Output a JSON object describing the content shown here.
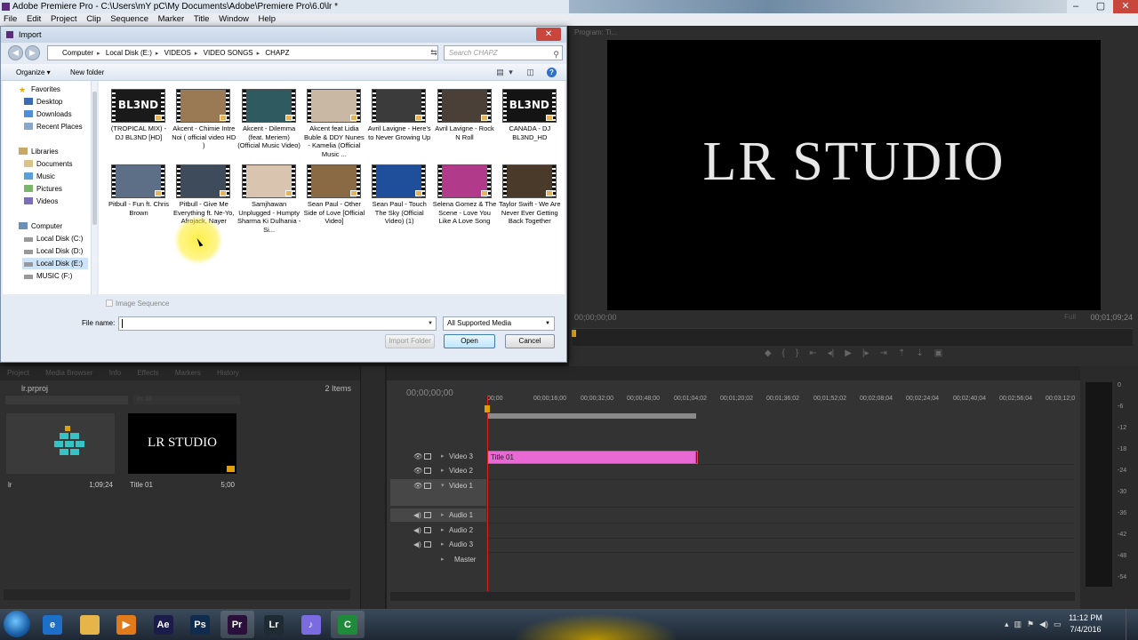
{
  "window": {
    "title": "Adobe Premiere Pro - C:\\Users\\mY pC\\My Documents\\Adobe\\Premiere Pro\\6.0\\lr *",
    "controls": [
      "–",
      "▢",
      "✕"
    ]
  },
  "menu": [
    "File",
    "Edit",
    "Project",
    "Clip",
    "Sequence",
    "Marker",
    "Title",
    "Window",
    "Help"
  ],
  "import_dialog": {
    "title": "Import",
    "breadcrumb": [
      "Computer",
      "Local Disk (E:)",
      "VIDEOS",
      "VIDEO SONGS",
      "CHAPZ"
    ],
    "search_placeholder": "Search CHAPZ",
    "toolbar": {
      "organize": "Organize ▾",
      "new_folder": "New folder"
    },
    "nav": {
      "favorites_header": "Favorites",
      "favorites": [
        "Desktop",
        "Downloads",
        "Recent Places"
      ],
      "libraries_header": "Libraries",
      "libraries": [
        "Documents",
        "Music",
        "Pictures",
        "Videos"
      ],
      "computer_header": "Computer",
      "drives": [
        "Local Disk (C:)",
        "Local Disk (D:)",
        "Local Disk (E:)",
        "MUSIC (F:)"
      ]
    },
    "files": [
      {
        "name": "(TROPICAL MIX) - DJ BL3ND [HD]",
        "thumb": "#1a1a1a",
        "text": "BL3ND"
      },
      {
        "name": "Akcent - Chimie Intre Noi ( official video HD )",
        "thumb": "#9a7a55",
        "text": ""
      },
      {
        "name": "Akcent - Dilemma (feat. Meriem) (Official Music Video)",
        "thumb": "#2f5a5f",
        "text": ""
      },
      {
        "name": "Akcent feat Lidia Buble & DDY Nunes - Kamelia (Official Music ...",
        "thumb": "#c9b8a3",
        "text": ""
      },
      {
        "name": "Avril Lavigne - Here's to Never Growing Up",
        "thumb": "#3b3b3b",
        "text": ""
      },
      {
        "name": "Avril Lavigne - Rock N Roll",
        "thumb": "#4a4038",
        "text": ""
      },
      {
        "name": "CANADA - DJ BL3ND_HD",
        "thumb": "#141414",
        "text": "BL3ND"
      },
      {
        "name": "Pitbull - Fun ft. Chris Brown",
        "thumb": "#5d6f86",
        "text": ""
      },
      {
        "name": "Pitbull - Give Me Everything ft. Ne-Yo, Afrojack, Nayer",
        "thumb": "#3e4b5a",
        "text": ""
      },
      {
        "name": "Samjhawan Unplugged - Humpty Sharma Ki Dulhania - Si...",
        "thumb": "#d9c4b0",
        "text": ""
      },
      {
        "name": "Sean Paul - Other Side of Love [Official Video]",
        "thumb": "#8a6a45",
        "text": ""
      },
      {
        "name": "Sean Paul - Touch The Sky (Official Video) (1)",
        "thumb": "#1f4f9a",
        "text": ""
      },
      {
        "name": "Selena Gomez & The Scene - Love You Like A Love Song",
        "thumb": "#b23a8a",
        "text": ""
      },
      {
        "name": "Taylor Swift - We Are Never Ever Getting Back Together",
        "thumb": "#4a3a2a",
        "text": ""
      }
    ],
    "image_sequence_label": "Image Sequence",
    "file_name_label": "File name:",
    "file_name_value": "",
    "file_type": "All Supported Media",
    "buttons": {
      "import_folder": "Import Folder",
      "open": "Open",
      "cancel": "Cancel"
    }
  },
  "program_monitor": {
    "tab": "Program: Ti...",
    "title_text": "LR STUDIO",
    "timecode_left": "00;00;00;00",
    "timecode_right": "00;01;09;24",
    "fit": "Full"
  },
  "project_panel": {
    "tabs": [
      "Project",
      "Media Browser",
      "Info",
      "Effects",
      "Markers",
      "History"
    ],
    "project_name": "lr.prproj",
    "item_count": "2 Items",
    "in_label": "In: All",
    "items": [
      {
        "name": "lr",
        "duration": "1;09;24"
      },
      {
        "name": "Title 01",
        "duration": "5;00",
        "title_text": "LR STUDIO"
      }
    ]
  },
  "timeline": {
    "timecode": "00;00;00;00",
    "ruler": [
      "00;00",
      "00;00;16;00",
      "00;00;32;00",
      "00;00;48;00",
      "00;01;04;02",
      "00;01;20;02",
      "00;01;36;02",
      "00;01;52;02",
      "00;02;08;04",
      "00;02;24;04",
      "00;02;40;04",
      "00;02;56;04",
      "00;03;12;0"
    ],
    "tracks": [
      "Video 3",
      "Video 2",
      "Video 1",
      "Audio 1",
      "Audio 2",
      "Audio 3",
      "Master"
    ],
    "clip_name": "Title 01",
    "clip_color": "#e869d4"
  },
  "meters": {
    "labels": [
      "0",
      "-6",
      "-12",
      "-18",
      "-24",
      "-30",
      "-36",
      "-42",
      "-48",
      "-54"
    ]
  },
  "taskbar": {
    "apps": [
      {
        "name": "internet-explorer",
        "label": "e",
        "color": "#1e6fc7"
      },
      {
        "name": "file-explorer",
        "label": "",
        "color": "#e5b54a"
      },
      {
        "name": "media-player",
        "label": "▶",
        "color": "#e07a1a"
      },
      {
        "name": "after-effects",
        "label": "Ae",
        "color": "#1c1c4a"
      },
      {
        "name": "photoshop",
        "label": "Ps",
        "color": "#0f2b4d"
      },
      {
        "name": "premiere-pro",
        "label": "Pr",
        "color": "#2a0f3a"
      },
      {
        "name": "lightroom",
        "label": "Lr",
        "color": "#1f2b33"
      },
      {
        "name": "itunes",
        "label": "♪",
        "color": "#7a6be0"
      },
      {
        "name": "camtasia",
        "label": "C",
        "color": "#1f8a3a"
      }
    ],
    "time": "11:12 PM",
    "date": "7/4/2016"
  }
}
